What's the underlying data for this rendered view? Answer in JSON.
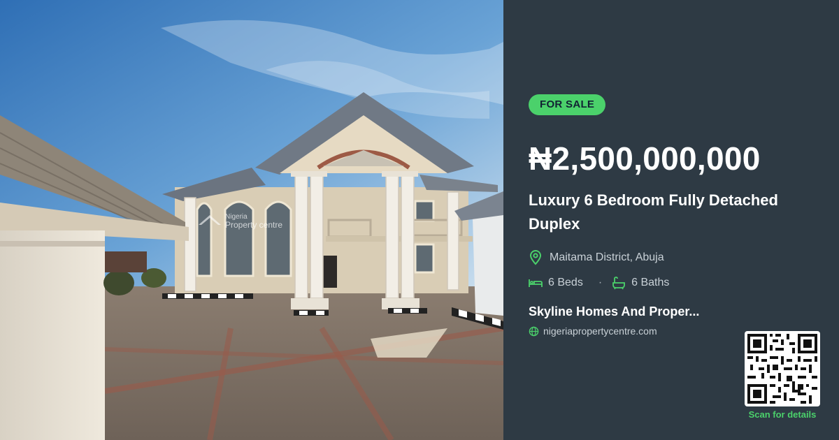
{
  "listing": {
    "status_badge": "FOR SALE",
    "price": "₦2,500,000,000",
    "title": "Luxury 6 Bedroom Fully Detached Duplex",
    "location": "Maitama District, Abuja",
    "beds": "6 Beds",
    "baths": "6 Baths",
    "agent": "Skyline Homes And Proper...",
    "website": "nigeriapropertycentre.com",
    "scan_label": "Scan for details"
  },
  "photo": {
    "watermark_line1": "Nigeria",
    "watermark_line2": "Property centre"
  },
  "icons": {
    "location": "map-pin-icon",
    "beds": "bed-icon",
    "baths": "bathtub-icon",
    "website": "globe-icon",
    "qr": "qr-code"
  },
  "colors": {
    "panel_bg": "#2e3a44",
    "accent_green": "#4bd16b",
    "text_primary": "#ffffff",
    "text_secondary": "#c9d1d7"
  }
}
